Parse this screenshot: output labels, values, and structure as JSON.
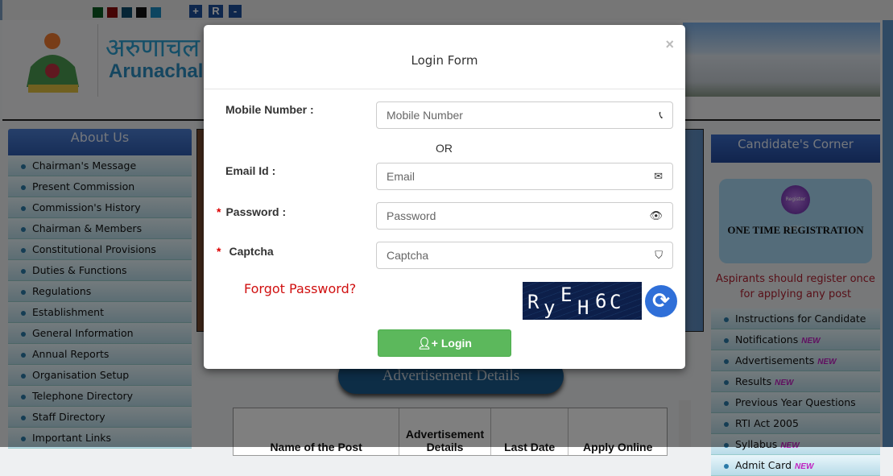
{
  "toolbar": {
    "theme_colors": [
      "#0b5a20",
      "#8a0a0a",
      "#0d4a6a",
      "#111111",
      "#1a8ac0"
    ],
    "font_increase": "+",
    "font_reset": "R",
    "font_decrease": "-"
  },
  "header": {
    "title_hindi": "अरुणाचल प्",
    "title_english": "Arunachal P"
  },
  "left_sidebar": {
    "heading": "About Us",
    "items": [
      "Chairman's Message",
      "Present Commission",
      "Commission's History",
      "Chairman & Members",
      "Constitutional Provisions",
      "Duties & Functions",
      "Regulations",
      "Establishment",
      "General Information",
      "Annual Reports",
      "Organisation Setup",
      "Telephone Directory",
      "Staff Directory",
      "Important Links"
    ]
  },
  "main": {
    "advertisement_title": "Advertisement Details",
    "table_headers": [
      "Name of the Post",
      "Advertisement Details",
      "Last Date",
      "Apply Online"
    ]
  },
  "right_sidebar": {
    "heading": "Candidate's Corner",
    "otr_badge": "Register HERE",
    "otr_title": "ONE TIME REGISTRATION",
    "otr_note": "Aspirants should register once for applying any post",
    "new_badge": "NEW",
    "items": [
      {
        "label": "Instructions for Candidate",
        "new": false
      },
      {
        "label": "Notifications",
        "new": true
      },
      {
        "label": "Advertisements",
        "new": true
      },
      {
        "label": "Results",
        "new": true
      },
      {
        "label": "Previous Year Questions",
        "new": false
      },
      {
        "label": "RTI Act 2005",
        "new": false
      },
      {
        "label": "Syllabus",
        "new": true
      },
      {
        "label": "Admit Card",
        "new": true
      }
    ]
  },
  "modal": {
    "title": "Login Form",
    "close": "×",
    "mobile_label": "Mobile Number :",
    "mobile_placeholder": "Mobile Number",
    "or": "OR",
    "email_label": "Email Id :",
    "email_placeholder": "Email",
    "password_label": "Password :",
    "password_placeholder": "Password",
    "captcha_label": "Captcha",
    "captcha_placeholder": "Captcha",
    "required_mark": "*",
    "forgot": "Forgot Password?",
    "captcha_chars": [
      "R",
      "y",
      "E",
      "H",
      "6",
      "C"
    ],
    "login": "Login"
  }
}
